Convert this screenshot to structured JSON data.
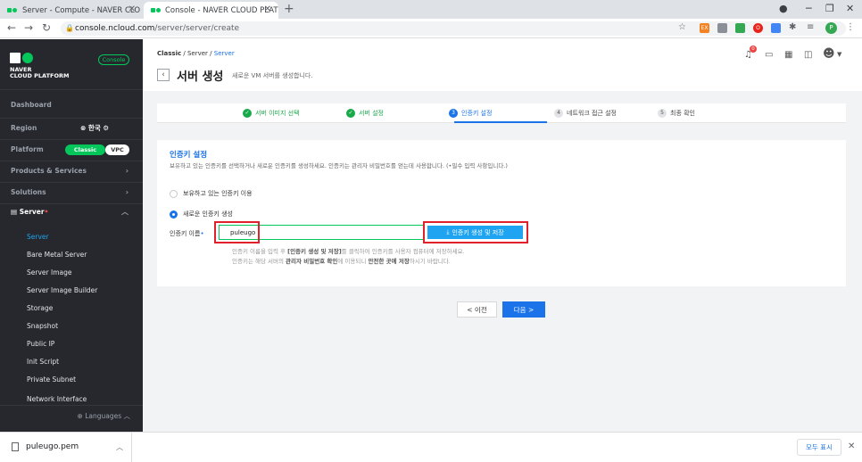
{
  "browser": {
    "tabs": [
      {
        "title": "Server - Compute - NAVER CLO",
        "active": false
      },
      {
        "title": "Console - NAVER CLOUD PLATF",
        "active": true
      }
    ],
    "url_host": "console.ncloud.com",
    "url_path": "/server/server/create",
    "extensions": [
      "EX",
      "O"
    ],
    "profile_initial": "P"
  },
  "sidebar": {
    "brand_line1": "NAVER",
    "brand_line2": "CLOUD PLATFORM",
    "console_label": "Console",
    "dashboard": "Dashboard",
    "region_label": "Region",
    "region_value": "한국",
    "platform_label": "Platform",
    "platform_options": [
      "Classic",
      "VPC"
    ],
    "products": "Products & Services",
    "solutions": "Solutions",
    "server_group": "Server",
    "server_items": [
      "Server",
      "Bare Metal Server",
      "Server Image",
      "Server Image Builder",
      "Storage",
      "Snapshot",
      "Public IP",
      "Init Script",
      "Private Subnet",
      "Network Interface"
    ],
    "languages": "Languages"
  },
  "header": {
    "breadcrumb": [
      "Classic",
      "Server",
      "Server"
    ],
    "title": "서버 생성",
    "subtitle": "새로운 VM 서버를 생성합니다.",
    "notif_count": "0"
  },
  "steps": [
    {
      "label": "서버 이미지 선택",
      "state": "done",
      "num": ""
    },
    {
      "label": "서버 설정",
      "state": "done",
      "num": ""
    },
    {
      "label": "인증키 설정",
      "state": "current",
      "num": "3"
    },
    {
      "label": "네트워크 접근 설정",
      "state": "todo",
      "num": "4"
    },
    {
      "label": "최종 확인",
      "state": "todo",
      "num": "5"
    }
  ],
  "panel": {
    "title": "인증키 설정",
    "description": "보유하고 있는 인증키를 선택하거나 새로운 인증키를 생성하세요. 인증키는 관리자 비밀번호를 얻는데 사용합니다. (•필수 입력 사항입니다.)",
    "option_existing": "보유하고 있는 인증키 이용",
    "option_new": "새로운 인증키 생성",
    "field_label": "인증키 이름",
    "field_value": "puleugo",
    "generate_button": "인증키 생성 및 저장",
    "note1_a": "인증키 이름을 입력 후 ",
    "note1_b": "[인증키 생성 및 저장]",
    "note1_c": "를 클릭하여 인증키를 사용자 컴퓨터에 저장하세요.",
    "note2_a": "인증키는 해당 서버의 ",
    "note2_b": "관리자 비밀번호 확인",
    "note2_c": "에 이용되니 ",
    "note2_d": "안전한 곳에 저장",
    "note2_e": "하시기 바랍니다."
  },
  "nav": {
    "prev": "< 이전",
    "next": "다음 >"
  },
  "download": {
    "filename": "puleugo.pem",
    "show_all": "모두 표시"
  }
}
